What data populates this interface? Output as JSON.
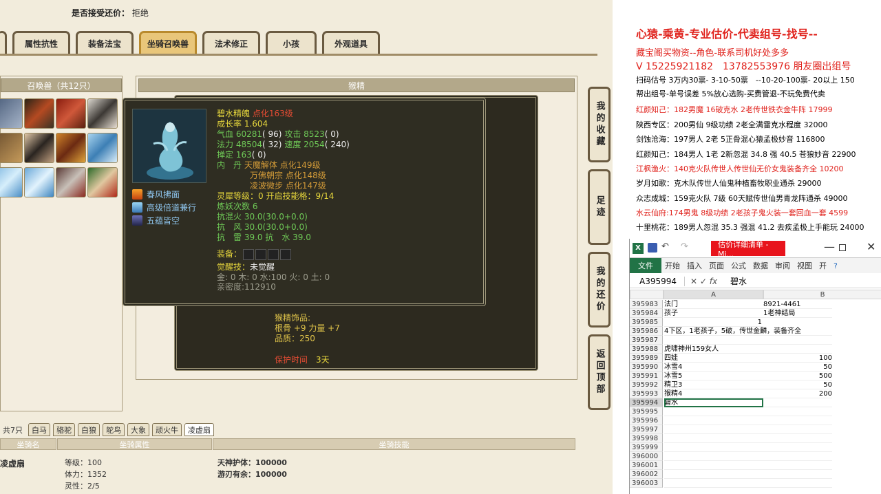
{
  "accept_label": "是否接受还价：",
  "accept_value": "拒绝",
  "tabs": [
    "属性抗性",
    "装备法宝",
    "坐骑召唤兽",
    "法术修正",
    "小孩",
    "外观道具"
  ],
  "pet_panel_title": "召唤兽（共12只）",
  "center_title": "猴精",
  "side_tabs": [
    "我的收藏",
    "足迹",
    "我的还价",
    "返回顶部"
  ],
  "pet": {
    "name": "碧水精魄",
    "upgrade": "点化163级",
    "growth": "成长率 1.604",
    "hp_label": "气血",
    "hp": "60281",
    "hp_b": "( 96)",
    "atk_label": "攻击",
    "atk": "8523",
    "atk_b": "( 0)",
    "mp_label": "法力",
    "mp": "48504",
    "mp_b": "( 32)",
    "spd_label": "速度",
    "spd": "2054",
    "spd_b": "( 240)",
    "def_label": "掸定",
    "def": "163",
    "def_b": "( 0)",
    "inner_label": "内　丹",
    "inner": [
      "天魔解体 点化149级",
      "万佛朝宗 点化148级",
      "凌波微步 点化147级"
    ],
    "spirit_label": "灵犀等级：",
    "spirit": "0 开启技能格：9/14",
    "refine": "炼妖次数 6",
    "res1": "抗混火 30.0(30.0+0.0)",
    "res2": "抗　风 30.0(30.0+0.0)",
    "res3": "抗　雷 39.0 抗　水 39.0",
    "equip_label": "装备：",
    "awake_label": "觉醒技：",
    "awake": "未觉醒",
    "elements": "金: 0 木: 0 水:100 火: 0 土: 0",
    "intimacy": "亲密度:112910",
    "skills": [
      "春风拂面",
      "高级倍道兼行",
      "五蕴皆空"
    ]
  },
  "back_window": {
    "acc_title": "猴精饰品:",
    "acc_attr": "根骨 +9 力量 +7",
    "acc_quality": "品质：250",
    "protect_label": "保护时间",
    "protect_value": "3天"
  },
  "bottom": {
    "count": "共7只",
    "tabs": [
      "白马",
      "骆驼",
      "白狼",
      "鸵鸟",
      "大象",
      "顽火牛",
      "凌虚扇"
    ],
    "head_name": "坐骑名",
    "head_attr": "坐骑属性",
    "head_skill": "坐骑技能",
    "mount_name": "凌虚扇",
    "attrs": [
      "等级：100",
      "体力：1352",
      "灵性：2/5"
    ],
    "skills": [
      "天神护体：100000",
      "游刃有余：100000"
    ]
  },
  "ads": [
    {
      "t": "心猿-乘黄-专业估价-代卖组号-找号--",
      "c": "#e0221c",
      "s": 16
    },
    {
      "t": "藏宝阁买物资--角色-联系司机好处多多",
      "c": "#e0221c",
      "s": 13
    },
    {
      "t": "V 15225921182　13782553976 朋友圈出组号",
      "c": "#e0221c",
      "s": 14
    },
    {
      "t": "扫码估号 3万内30票- 3-10-50票　--10-20-100票- 20以上 150",
      "c": "#000",
      "s": 11
    },
    {
      "t": "帮出组号-单号误差 5%放心选购-买费管退-不玩免费代卖",
      "c": "#000",
      "s": 11
    },
    {
      "t": "红颜知己：182男魔 16破克水 2老传世铁衣金牛阵 17999",
      "c": "#e0221c",
      "s": 11
    },
    {
      "t": "陕西专区：200男仙 9级功绩 2老全满雷克水程度 32000",
      "c": "#000",
      "s": 11
    },
    {
      "t": "剑蚀沧海：197男人 2老 5正骨混心猿孟极妙音 116800",
      "c": "#000",
      "s": 11
    },
    {
      "t": "红颜知己：184男人 1老 2新忽混 34.8 强 40.5 苍狼妙音 22900",
      "c": "#000",
      "s": 11
    },
    {
      "t": "江枫渔火：140克火队传世人传世仙无价女鬼装备齐全 10200",
      "c": "#e0221c",
      "s": 11
    },
    {
      "t": "岁月如歌：克木队传世人仙鬼种植畜牧职业通杀 29000",
      "c": "#000",
      "s": 11
    },
    {
      "t": "众志成城：159克火队 7级 60天赋传世仙男青龙阵通杀 49000",
      "c": "#000",
      "s": 11
    },
    {
      "t": "水云仙府:174男鬼 8级功绩 2老孩子鬼火装一套回血一套 4599",
      "c": "#e0221c",
      "s": 11
    },
    {
      "t": "十里桃花：189男人忽混 35.3 强混 41.2 去疾孟极上手能玩 24000",
      "c": "#000",
      "s": 11
    }
  ],
  "excel": {
    "title": "估价详细清单 - Mi...",
    "file_tab": "文件",
    "ribbon": [
      "开始",
      "插入",
      "页面",
      "公式",
      "数据",
      "审阅",
      "视图",
      "开"
    ],
    "cell_ref": "A395994",
    "formula": "碧水",
    "col_a": "A",
    "col_b": "B",
    "rows": [
      {
        "n": "395983",
        "a": "法门",
        "b": "8921-4461",
        "align": "left"
      },
      {
        "n": "395984",
        "a": "孩子",
        "b": "1老神结局",
        "align": "left"
      },
      {
        "n": "395985",
        "a": "",
        "b": "1",
        "align": "mid"
      },
      {
        "n": "395986",
        "a": "4下区，1老孩子，5破，传世金麟，装备齐全",
        "b": "",
        "align": "left"
      },
      {
        "n": "395987",
        "a": "",
        "b": "",
        "align": "left"
      },
      {
        "n": "395988",
        "a": "虎啸神州159女人",
        "b": "",
        "align": "left"
      },
      {
        "n": "395989",
        "a": "四娃",
        "b": "100",
        "align": "right"
      },
      {
        "n": "395990",
        "a": "冰雪4",
        "b": "50",
        "align": "right"
      },
      {
        "n": "395991",
        "a": "冰雪5",
        "b": "500",
        "align": "right"
      },
      {
        "n": "395992",
        "a": "精卫3",
        "b": "50",
        "align": "right"
      },
      {
        "n": "395993",
        "a": "猴精4",
        "b": "200",
        "align": "right"
      },
      {
        "n": "395994",
        "a": "碧水",
        "b": "",
        "align": "left"
      },
      {
        "n": "395995",
        "a": "",
        "b": "",
        "align": "left"
      },
      {
        "n": "395996",
        "a": "",
        "b": "",
        "align": "left"
      },
      {
        "n": "395997",
        "a": "",
        "b": "",
        "align": "left"
      },
      {
        "n": "395998",
        "a": "",
        "b": "",
        "align": "left"
      },
      {
        "n": "395999",
        "a": "",
        "b": "",
        "align": "left"
      },
      {
        "n": "396000",
        "a": "",
        "b": "",
        "align": "left"
      },
      {
        "n": "396001",
        "a": "",
        "b": "",
        "align": "left"
      },
      {
        "n": "396002",
        "a": "",
        "b": "",
        "align": "left"
      },
      {
        "n": "396003",
        "a": "",
        "b": "",
        "align": "left"
      }
    ]
  }
}
